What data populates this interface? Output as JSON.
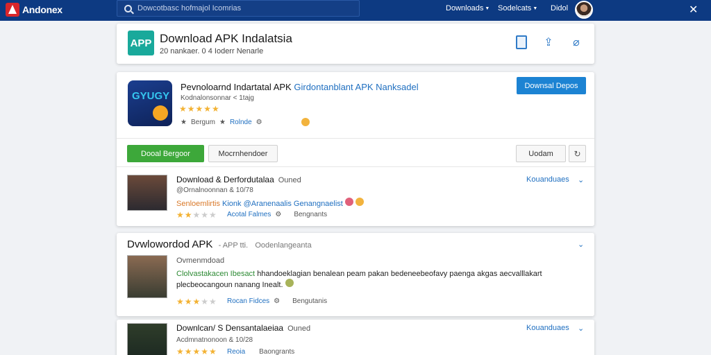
{
  "topbar": {
    "brand": "Andonex",
    "search_placeholder": "Dowcotbasc hofmajol Icomrias",
    "nav": [
      "Downloads",
      "Sodelcats",
      "Didol"
    ],
    "colors": {
      "bar": "#0d3a82",
      "accent": "#1c83d3"
    }
  },
  "header": {
    "badge": "APP",
    "title": "Download APK Indalatsia",
    "subtitle": "20 nankaer. 0 4 Ioderr Nenarle",
    "icons": [
      "document-icon",
      "share-icon",
      "link-icon"
    ]
  },
  "app": {
    "title": "Pevnoloarnd Indartatal APK",
    "title_blue": "Girdontanblant APK Nanksadel",
    "subtitle": "Kodnalonsonnar < 1tajg",
    "rating": 5,
    "meta_a": "Bergum",
    "meta_b": "Rolnde",
    "download_button": "Downsal Depos",
    "primary_button": "Dooal Bergoor",
    "secondary_button": "Mocrnhendoer",
    "small_button": "Uodam",
    "square_button": "↻"
  },
  "reviews": [
    {
      "title": "Download & Derfordutalaa",
      "tag": "Ouned",
      "sub": "@Ornalnoonnan & 10/78",
      "text_orange": "Senloemlirtis",
      "text_blue": "Kionk @Aranenaalis Genangnaelist",
      "link": "Kouanduaes",
      "rating": 2,
      "footer_a": "Acotal Falmes",
      "footer_b": "Bengnants"
    },
    {
      "title": "Dvwlowordod APK",
      "title_dim": "- APP tti.",
      "tag": "Oodenlangeanta",
      "sub": "Ovmenmdoad",
      "text_green": "Clolvastakacen Ibesact",
      "text_rest": "hhandoeklagian benalean peam pakan bedeneebeofavy paenga akgas aecvalllakart plecbeocangoun nanang Inealt.",
      "rating": 3,
      "footer_a": "Rocan Fidces",
      "footer_b": "Bengutanis"
    },
    {
      "title": "Downlcan/ S Densantalaeiaa",
      "tag": "Ouned",
      "sub": "Acdmnatnonoon & 10/28",
      "link": "Kouanduaes",
      "rating": 5,
      "footer_a": "Reoia",
      "footer_b": "Baongrants"
    }
  ]
}
